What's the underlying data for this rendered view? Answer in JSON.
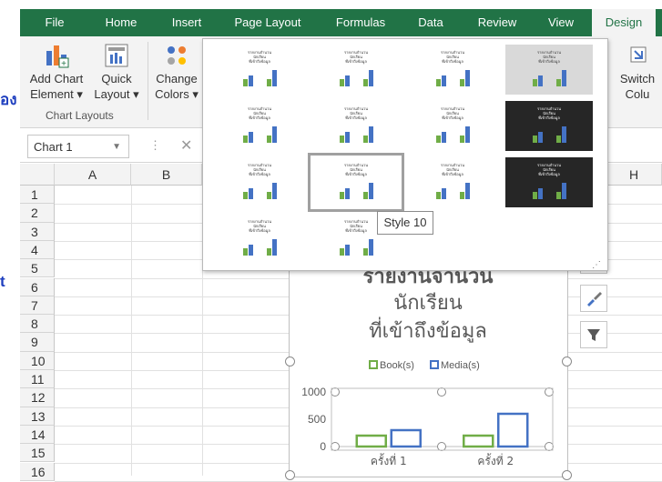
{
  "ribbon": {
    "tabs": [
      "File",
      "Home",
      "Insert",
      "Page Layout",
      "Formulas",
      "Data",
      "Review",
      "View",
      "Design"
    ],
    "active_tab": "Design",
    "add_chart_element": [
      "Add Chart",
      "Element"
    ],
    "quick_layout": [
      "Quick",
      "Layout"
    ],
    "change_colors": [
      "Change",
      "Colors"
    ],
    "group_label": "Chart Layouts",
    "switch_row_col": [
      "Switch",
      "Colu"
    ]
  },
  "left_cut_text": [
    "อง",
    "t"
  ],
  "name_box": "Chart 1",
  "columns": [
    "A",
    "B",
    "H"
  ],
  "rows": [
    "1",
    "2",
    "3",
    "4",
    "5",
    "6",
    "7",
    "8",
    "9",
    "10",
    "11",
    "12",
    "13",
    "14",
    "15",
    "16"
  ],
  "tooltip": "Style 10",
  "gallery_thumb_title": [
    "รายงานจำนวน",
    "นักเรียน",
    "ที่เข้าถึงข้อมูล"
  ],
  "chart_data": {
    "type": "bar",
    "title": [
      "รายงานจำนวน",
      "นักเรียน",
      "ที่เข้าถึงข้อมูล"
    ],
    "categories": [
      "ครั้งที่ 1",
      "ครั้งที่ 2"
    ],
    "series": [
      {
        "name": "Book(s)",
        "values": [
          200,
          200
        ],
        "color": "#70ad47"
      },
      {
        "name": "Media(s)",
        "values": [
          300,
          600
        ],
        "color": "#4472c4"
      }
    ],
    "ylim": [
      0,
      1000
    ],
    "yticks": [
      "0",
      "500",
      "1000"
    ],
    "legend": "top"
  }
}
